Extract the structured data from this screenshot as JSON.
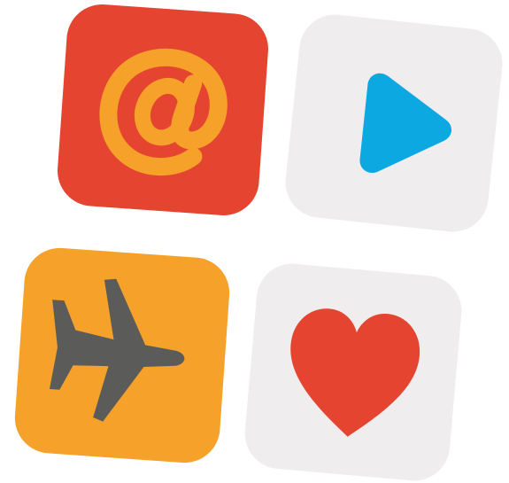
{
  "tiles": [
    {
      "id": "email",
      "icon": "at-sign-icon",
      "bg": "#E54530",
      "fg": "#F5A12A"
    },
    {
      "id": "play",
      "icon": "play-icon",
      "bg": "#EFEDED",
      "fg": "#0BA8E2"
    },
    {
      "id": "plane",
      "icon": "airplane-icon",
      "bg": "#F5A12A",
      "fg": "#5B5B5A"
    },
    {
      "id": "heart",
      "icon": "heart-icon",
      "bg": "#EFEDED",
      "fg": "#E54530"
    }
  ]
}
